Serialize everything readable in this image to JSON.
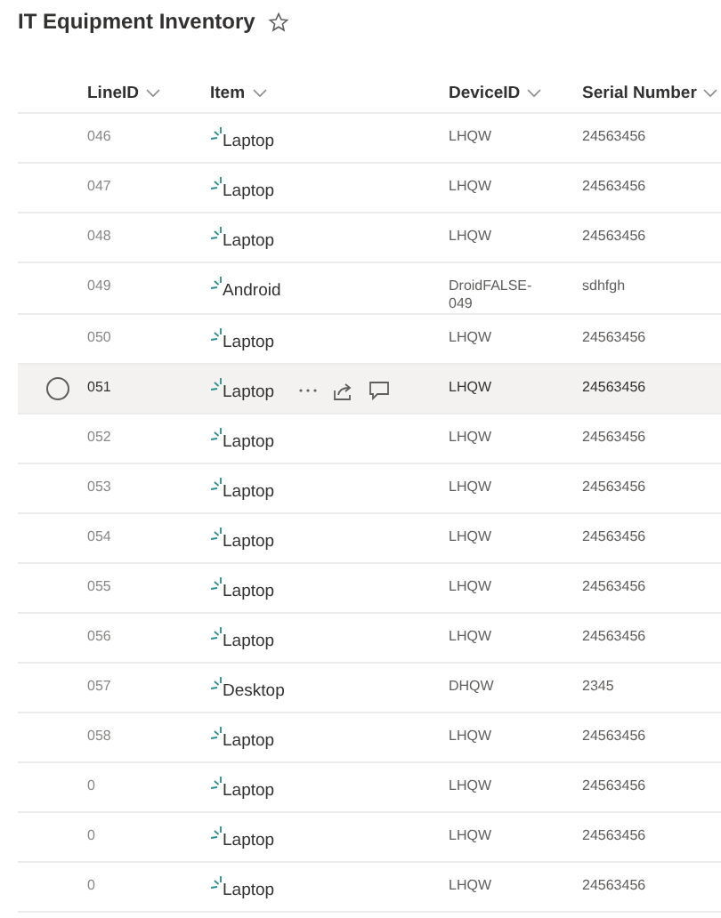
{
  "list": {
    "title": "IT Equipment Inventory",
    "favorite": false
  },
  "columns": [
    {
      "label": "LineID"
    },
    {
      "label": "Item"
    },
    {
      "label": "DeviceID"
    },
    {
      "label": "Serial Number"
    }
  ],
  "rows": [
    {
      "line_id": "046",
      "item": "Laptop",
      "device_id": "LHQW",
      "serial": "24563456",
      "hovered": false
    },
    {
      "line_id": "047",
      "item": "Laptop",
      "device_id": "LHQW",
      "serial": "24563456",
      "hovered": false
    },
    {
      "line_id": "048",
      "item": "Laptop",
      "device_id": "LHQW",
      "serial": "24563456",
      "hovered": false
    },
    {
      "line_id": "049",
      "item": "Android",
      "device_id": "DroidFALSE-049",
      "serial": "sdhfgh",
      "hovered": false
    },
    {
      "line_id": "050",
      "item": "Laptop",
      "device_id": "LHQW",
      "serial": "24563456",
      "hovered": false
    },
    {
      "line_id": "051",
      "item": "Laptop",
      "device_id": "LHQW",
      "serial": "24563456",
      "hovered": true
    },
    {
      "line_id": "052",
      "item": "Laptop",
      "device_id": "LHQW",
      "serial": "24563456",
      "hovered": false
    },
    {
      "line_id": "053",
      "item": "Laptop",
      "device_id": "LHQW",
      "serial": "24563456",
      "hovered": false
    },
    {
      "line_id": "054",
      "item": "Laptop",
      "device_id": "LHQW",
      "serial": "24563456",
      "hovered": false
    },
    {
      "line_id": "055",
      "item": "Laptop",
      "device_id": "LHQW",
      "serial": "24563456",
      "hovered": false
    },
    {
      "line_id": "056",
      "item": "Laptop",
      "device_id": "LHQW",
      "serial": "24563456",
      "hovered": false
    },
    {
      "line_id": "057",
      "item": "Desktop",
      "device_id": "DHQW",
      "serial": "2345",
      "hovered": false
    },
    {
      "line_id": "058",
      "item": "Laptop",
      "device_id": "LHQW",
      "serial": "24563456",
      "hovered": false
    },
    {
      "line_id": "0",
      "item": "Laptop",
      "device_id": "LHQW",
      "serial": "24563456",
      "hovered": false
    },
    {
      "line_id": "0",
      "item": "Laptop",
      "device_id": "LHQW",
      "serial": "24563456",
      "hovered": false
    },
    {
      "line_id": "0",
      "item": "Laptop",
      "device_id": "LHQW",
      "serial": "24563456",
      "hovered": false
    }
  ]
}
